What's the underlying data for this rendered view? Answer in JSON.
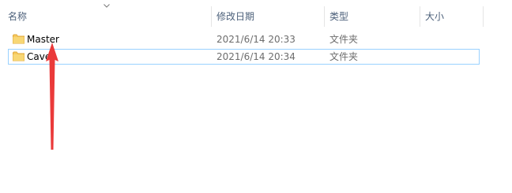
{
  "header": {
    "columns": {
      "name": "名称",
      "date": "修改日期",
      "type": "类型",
      "size": "大小"
    }
  },
  "rows": [
    {
      "name": "Master",
      "date": "2021/6/14 20:33",
      "type": "文件夹",
      "size": "",
      "icon": "folder-icon",
      "selected": false
    },
    {
      "name": "Cave",
      "date": "2021/6/14 20:34",
      "type": "文件夹",
      "size": "",
      "icon": "folder-icon",
      "selected": true
    }
  ],
  "colors": {
    "header_text": "#4c607a",
    "folder": "#f6c95f",
    "folder_tab": "#e0a93a",
    "selection_border": "#99d1ff",
    "arrow": "#ea3a3a"
  }
}
